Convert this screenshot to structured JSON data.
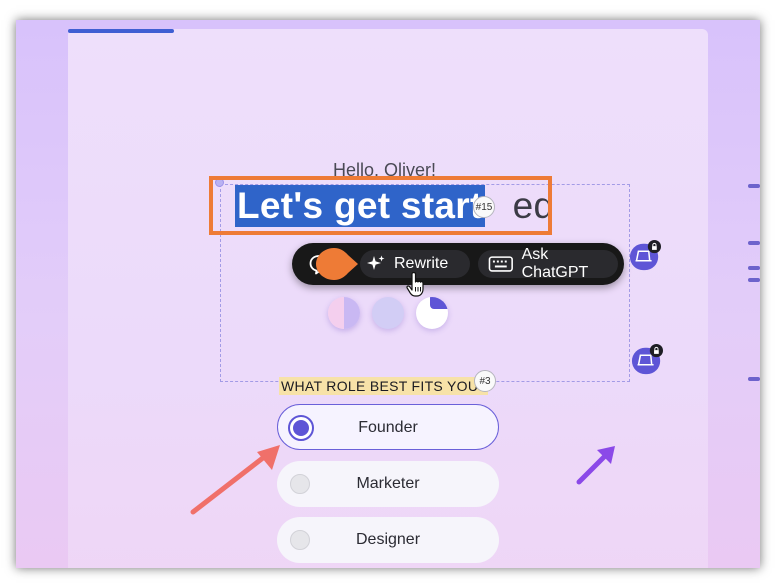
{
  "header": {
    "greeting": "Hello, Oliver!",
    "headline_selected": "Let's get start",
    "headline_rest": "ed",
    "headline_tag": "#15"
  },
  "toolbar": {
    "rewrite_label": "Rewrite",
    "ask_label": "Ask ChatGPT"
  },
  "swatches": [
    "#e5c6ef",
    "#d2cdf5",
    "#ffffff"
  ],
  "question": {
    "label": "WHAT ROLE BEST FITS YOU?",
    "tag": "#3"
  },
  "options": [
    {
      "label": "Founder",
      "selected": true
    },
    {
      "label": "Marketer",
      "selected": false
    },
    {
      "label": "Designer",
      "selected": false
    }
  ],
  "colors": {
    "accent": "#5e55d6",
    "selection": "#2f64c9",
    "highlight_box": "#ee7b36",
    "annotation_arrow_red": "#f0706a",
    "annotation_arrow_purple": "#8b49e8"
  }
}
